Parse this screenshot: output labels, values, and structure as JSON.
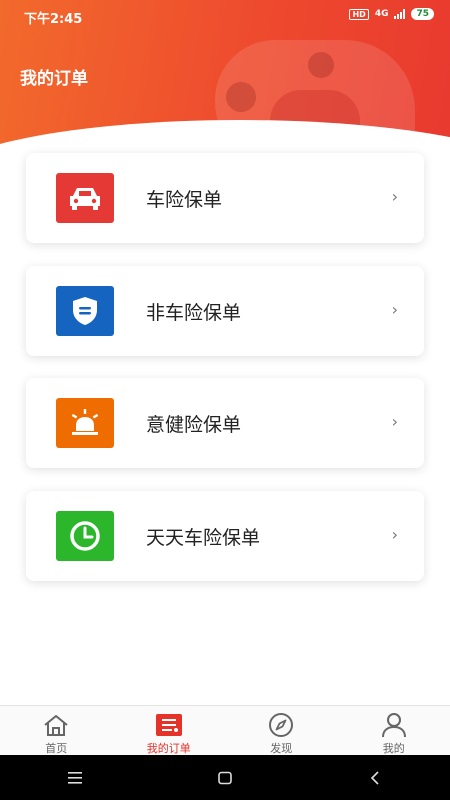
{
  "status_bar": {
    "time": "下午2:45",
    "hd": "HD",
    "network": "4G",
    "battery": "75"
  },
  "header": {
    "title": "我的订单"
  },
  "colors": {
    "accent": "#e6332a",
    "car": "#e53935",
    "noncar": "#1565c0",
    "accident": "#ef6c00",
    "daily": "#2bb62b"
  },
  "cards": [
    {
      "label": "车险保单",
      "icon": "car-icon",
      "chevron": "›"
    },
    {
      "label": "非车险保单",
      "icon": "shield-icon",
      "chevron": "›"
    },
    {
      "label": "意健险保单",
      "icon": "alarm-light-icon",
      "chevron": "›"
    },
    {
      "label": "天天车险保单",
      "icon": "clock-icon",
      "chevron": "›"
    }
  ],
  "bottom_nav": [
    {
      "label": "首页",
      "icon": "home-icon"
    },
    {
      "label": "我的订单",
      "icon": "order-list-icon",
      "active": true
    },
    {
      "label": "发现",
      "icon": "compass-icon"
    },
    {
      "label": "我的",
      "icon": "user-icon"
    }
  ],
  "system_nav": {
    "menu": "menu-icon",
    "home": "home-square-icon",
    "back": "back-icon"
  }
}
